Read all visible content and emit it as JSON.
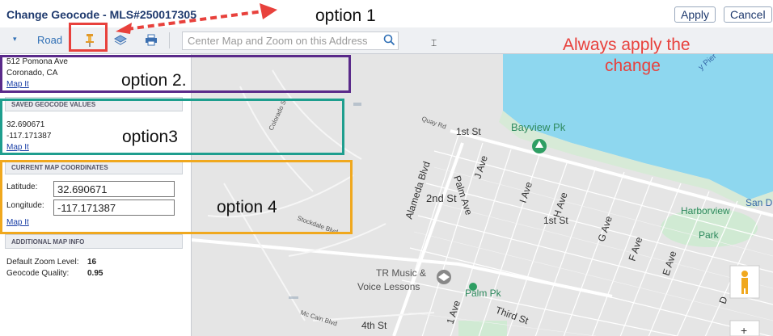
{
  "window": {
    "title": "Change Geocode - MLS#250017305"
  },
  "actions": {
    "apply": "Apply",
    "cancel": "Cancel"
  },
  "toolbar": {
    "road": "Road",
    "search_placeholder": "Center Map and Zoom on this Address"
  },
  "address": {
    "line1": "512 Pomona Ave",
    "line2": "Coronado, CA",
    "map_it": "Map It"
  },
  "saved": {
    "heading": "SAVED GEOCODE VALUES",
    "lat": "32.690671",
    "lng": "-117.171387",
    "map_it": "Map It"
  },
  "current": {
    "heading": "CURRENT MAP COORDINATES",
    "lat_label": "Latitude:",
    "lat_value": "32.690671",
    "lng_label": "Longitude:",
    "lng_value": "-117.171387",
    "map_it": "Map It"
  },
  "additional": {
    "heading": "ADDITIONAL MAP INFO",
    "zoom_label": "Default Zoom Level:",
    "zoom_value": "16",
    "quality_label": "Geocode Quality:",
    "quality_value": "0.95"
  },
  "map": {
    "streets": [
      "1st St",
      "2nd St",
      "Quay Rd",
      "Alameda Blvd",
      "Palm Ave",
      "J Ave",
      "I Ave",
      "H Ave",
      "G Ave",
      "F Ave",
      "E Ave",
      "Colorado St",
      "Stockdale Blvd",
      "Mc Cain Blvd",
      "4th St",
      "Third St",
      "1 Ave",
      "1st St",
      "D"
    ],
    "pois": [
      "Bayview Pk",
      "TR Music &",
      "Voice Lessons",
      "Palm Pk",
      "Harborview",
      "Park",
      "San D",
      "y Pier"
    ]
  },
  "annotations": {
    "option1": "option 1",
    "option2": "option 2.",
    "option3": "option3",
    "option4": "option 4",
    "note_line1": "Always apply the",
    "note_line2": "change"
  },
  "colors": {
    "option1": "#e8413c",
    "option2": "#5a2a8a",
    "option3": "#1e9e8e",
    "option4": "#f0a81e",
    "water": "#8ed7ef"
  }
}
